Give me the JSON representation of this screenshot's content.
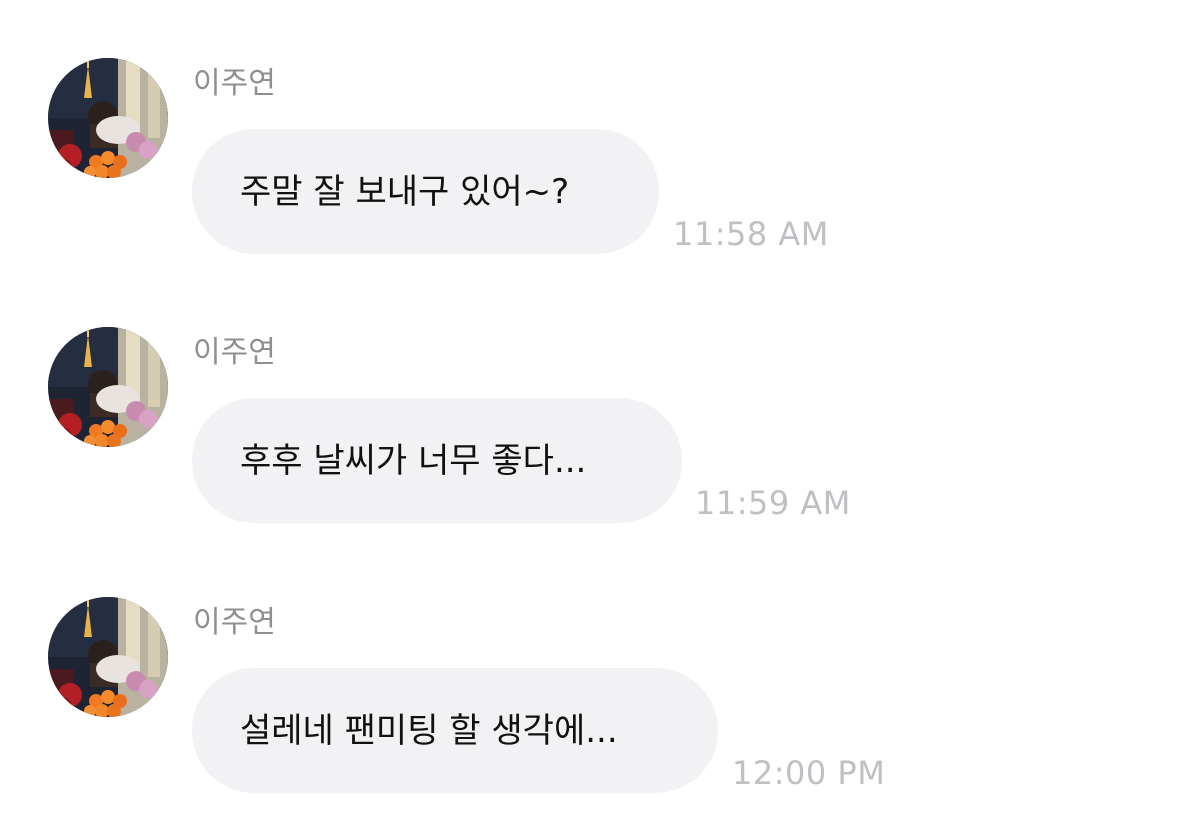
{
  "messages": [
    {
      "sender": "이주연",
      "text": "주말 잘 보내구 있어~?",
      "time": "11:58 AM",
      "avatar_icon": "profile-photo"
    },
    {
      "sender": "이주연",
      "text": "후후 날씨가 너무 좋다...",
      "time": "11:59 AM",
      "avatar_icon": "profile-photo"
    },
    {
      "sender": "이주연",
      "text": "설레네 팬미팅 할 생각에...",
      "time": "12:00 PM",
      "avatar_icon": "profile-photo"
    }
  ],
  "colors": {
    "bubble": "#f2f2f4",
    "sender": "#8e8e93",
    "time": "#c0c0c4",
    "text": "#111111"
  }
}
